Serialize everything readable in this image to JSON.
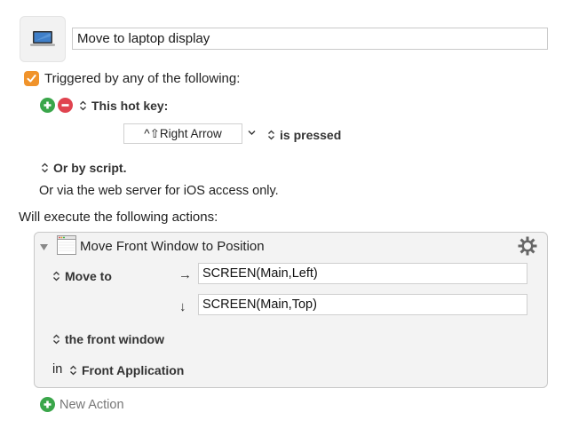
{
  "macro": {
    "icon": "laptop-icon",
    "name": "Move to laptop display"
  },
  "trigger": {
    "checkbox_checked": true,
    "heading": "Triggered by any of the following:",
    "hotkey_section_label": "This hot key:",
    "hotkey_value": "^⇧Right Arrow",
    "hotkey_condition": "is pressed",
    "script_label": "Or by script.",
    "web_server_text": "Or via the web server for iOS access only."
  },
  "actions": {
    "heading": "Will execute the following actions:",
    "items": [
      {
        "title": "Move Front Window to Position",
        "icon": "window-icon",
        "mode_label": "Move to",
        "x_arrow": "→",
        "x_value": "SCREEN(Main,Left)",
        "y_arrow": "↓",
        "y_value": "SCREEN(Main,Top)",
        "window_label": "the front window",
        "in_label": "in",
        "application_label": "Front Application"
      }
    ],
    "new_action_label": "New Action"
  },
  "colors": {
    "checkbox": "#f0932b",
    "add": "#3aa64a",
    "remove": "#e0434f"
  }
}
